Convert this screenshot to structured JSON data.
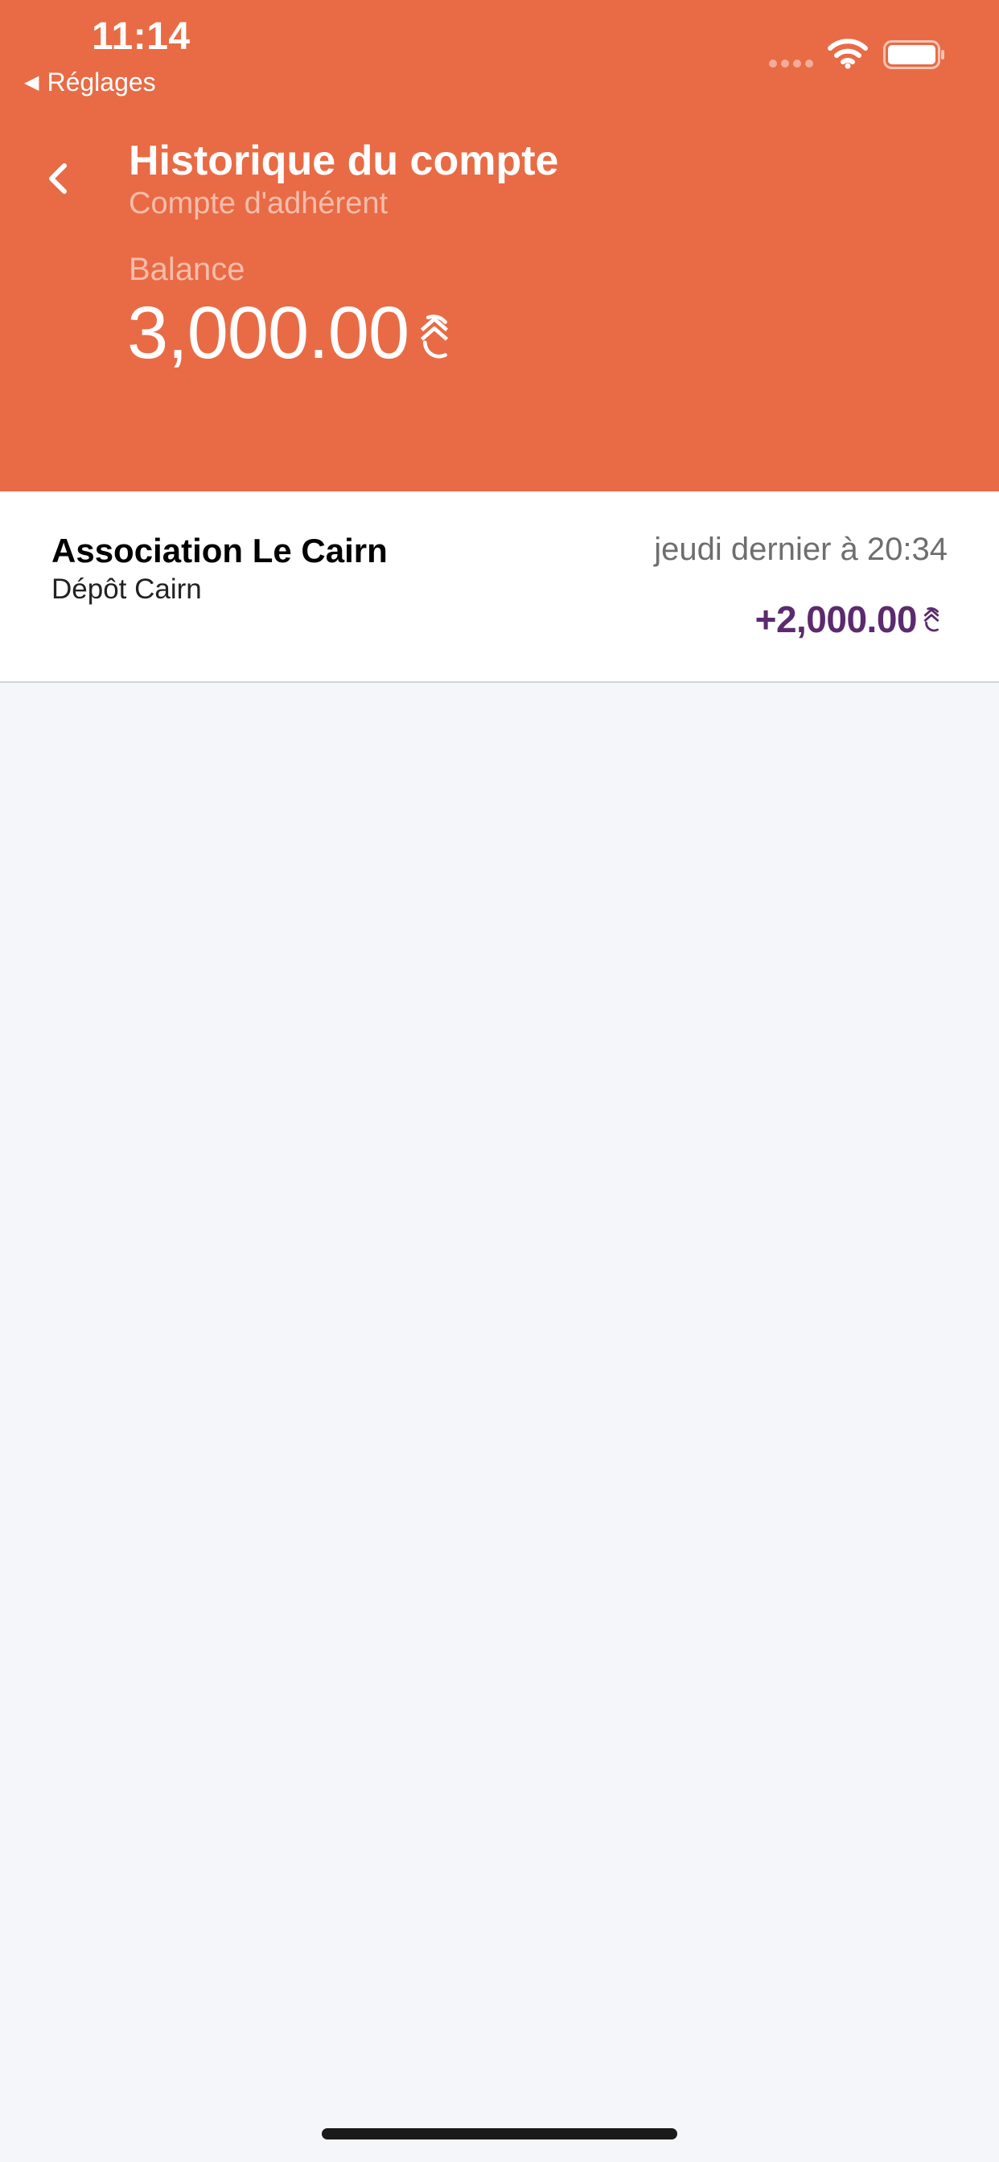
{
  "status_bar": {
    "time": "11:14",
    "back_label": "Réglages",
    "back_arrow": "◀",
    "icons": [
      "signal-dots-icon",
      "wifi-icon",
      "battery-icon"
    ]
  },
  "header": {
    "title": "Historique du compte",
    "subtitle": "Compte d'adhérent",
    "balance_label": "Balance",
    "balance_value": "3,000.00",
    "currency_icon": "cairn-currency-icon",
    "background_color": "#e86b45"
  },
  "transactions": [
    {
      "name": "Association Le Cairn",
      "description": "Dépôt Cairn",
      "date": "jeudi dernier à 20:34",
      "amount": "+2,000.00",
      "amount_color": "#5b2b6e"
    }
  ]
}
